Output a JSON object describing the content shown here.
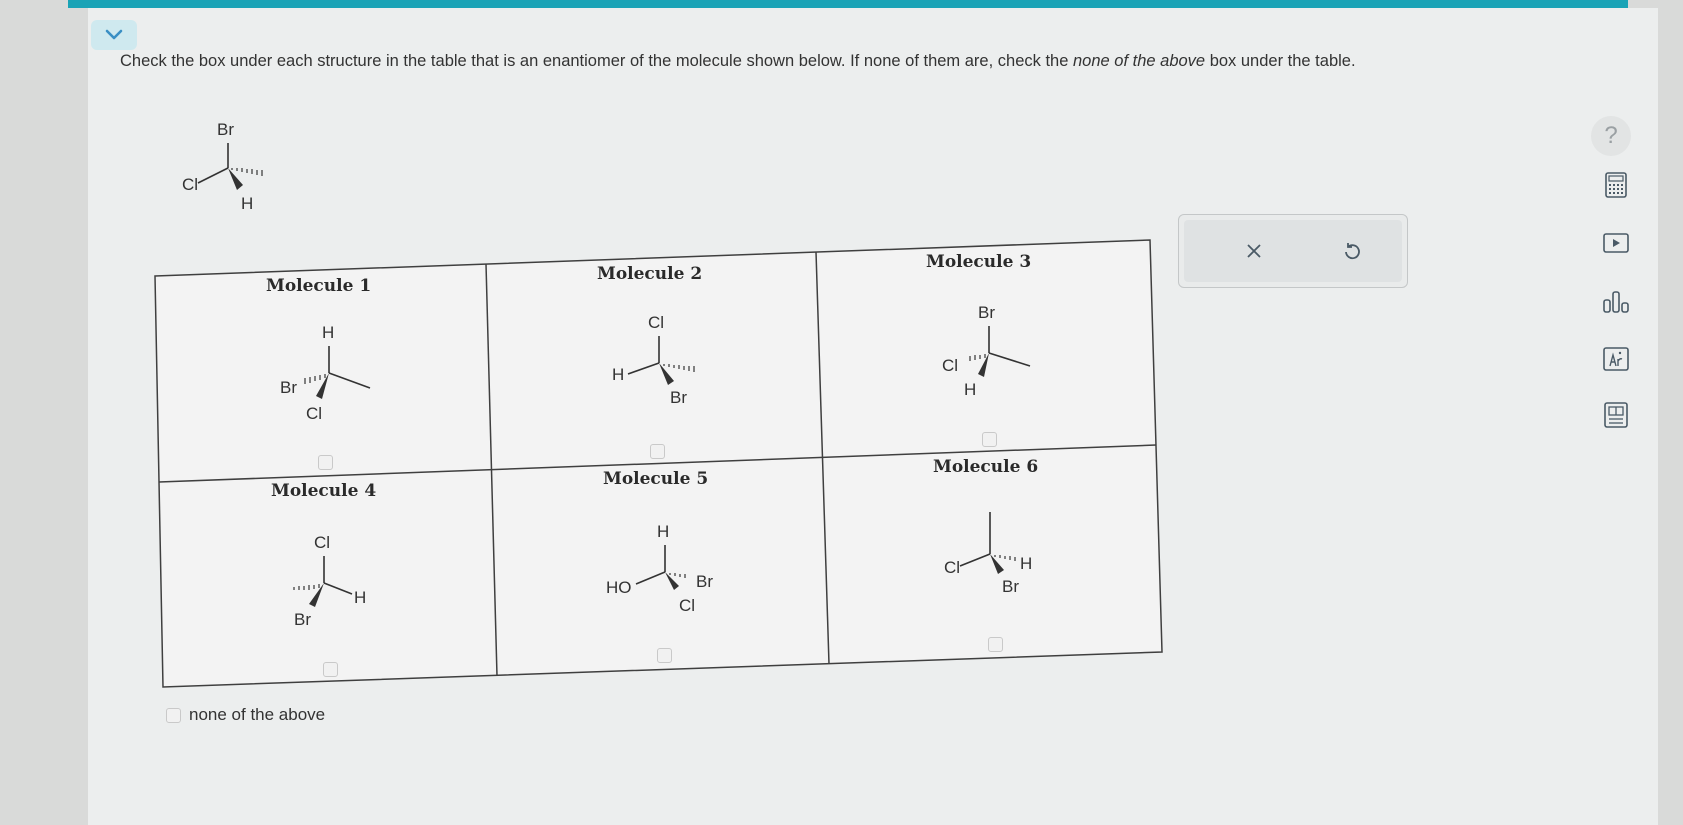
{
  "question": {
    "part1": "Check the box under each structure in the table that is an enantiomer of the molecule shown below. If none of them are, check the ",
    "em": "none of the above",
    "part2": " box under the table."
  },
  "reference": {
    "top": "Br",
    "left": "Cl",
    "bottom": "H"
  },
  "molecules": [
    {
      "title": "Molecule 1",
      "labels": {
        "top": "H",
        "left": "Br",
        "bottom": "Cl"
      }
    },
    {
      "title": "Molecule 2",
      "labels": {
        "top": "Cl",
        "left": "H",
        "bottom": "Br"
      }
    },
    {
      "title": "Molecule 3",
      "labels": {
        "top": "Br",
        "left": "Cl",
        "bottom": "H"
      }
    },
    {
      "title": "Molecule 4",
      "labels": {
        "top": "Cl",
        "right": "H",
        "bottom": "Br"
      }
    },
    {
      "title": "Molecule 5",
      "labels": {
        "top": "H",
        "left": "HO",
        "right": "Br",
        "bottom": "Cl"
      }
    },
    {
      "title": "Molecule 6",
      "labels": {
        "left": "Cl",
        "right": "H",
        "bottom": "Br"
      }
    }
  ],
  "none_label": "none of the above",
  "help_label": "?",
  "tools": [
    "calculator-icon",
    "video-icon",
    "chart-icon",
    "periodic-table-icon",
    "reference-icon"
  ],
  "colors": {
    "accent": "#1aa3b6",
    "collapse": "#3a8fc4",
    "background": "#eceeee"
  }
}
